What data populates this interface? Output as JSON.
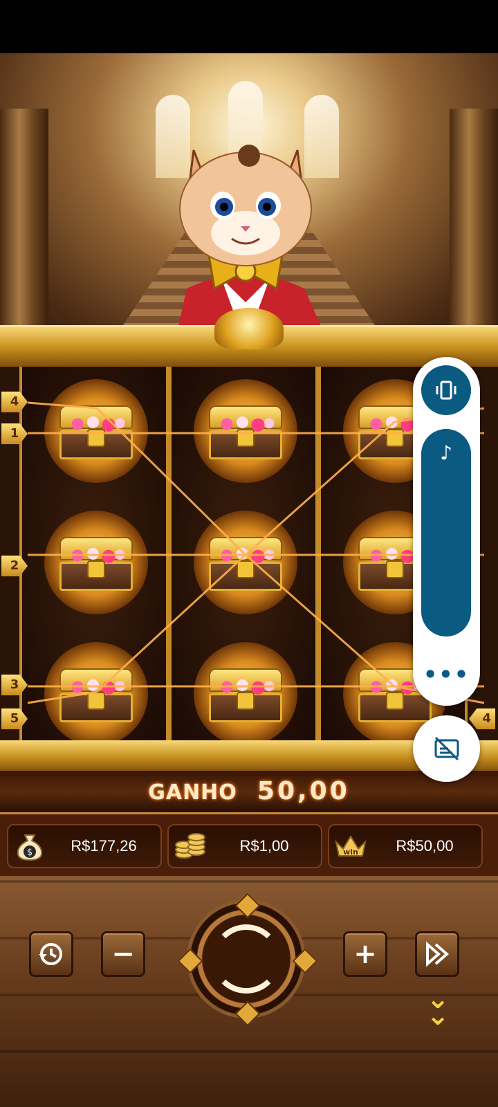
{
  "win": {
    "label": "GANHO",
    "value": "50,00"
  },
  "info": {
    "balance": "R$177,26",
    "bet": "R$1,00",
    "win_amount": "R$50,00",
    "win_icon_text": "win"
  },
  "paylines": {
    "left": [
      "4",
      "1",
      "2",
      "3",
      "5"
    ],
    "right": [
      "4"
    ]
  },
  "controls": {
    "minus_label": "−",
    "plus_label": "+"
  },
  "overlay": {
    "more_label": "•••"
  },
  "grid": {
    "symbol": "treasure-chest",
    "rows": 3,
    "cols": 3
  }
}
